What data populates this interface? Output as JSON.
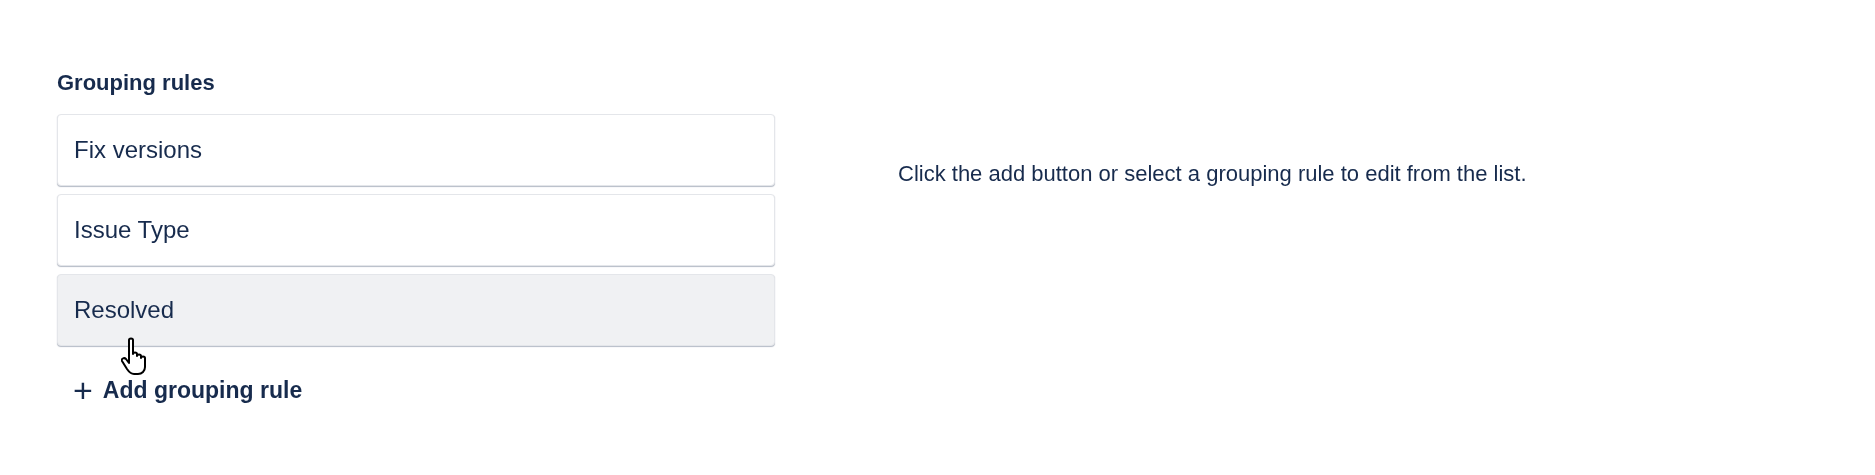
{
  "grouping_rules": {
    "title": "Grouping rules",
    "items": [
      {
        "label": "Fix versions",
        "hovered": false
      },
      {
        "label": "Issue Type",
        "hovered": false
      },
      {
        "label": "Resolved",
        "hovered": true
      }
    ],
    "add_button": {
      "icon": "+",
      "label": "Add grouping rule"
    }
  },
  "detail_panel": {
    "message": "Click the add button or select a grouping rule to edit from the list."
  }
}
